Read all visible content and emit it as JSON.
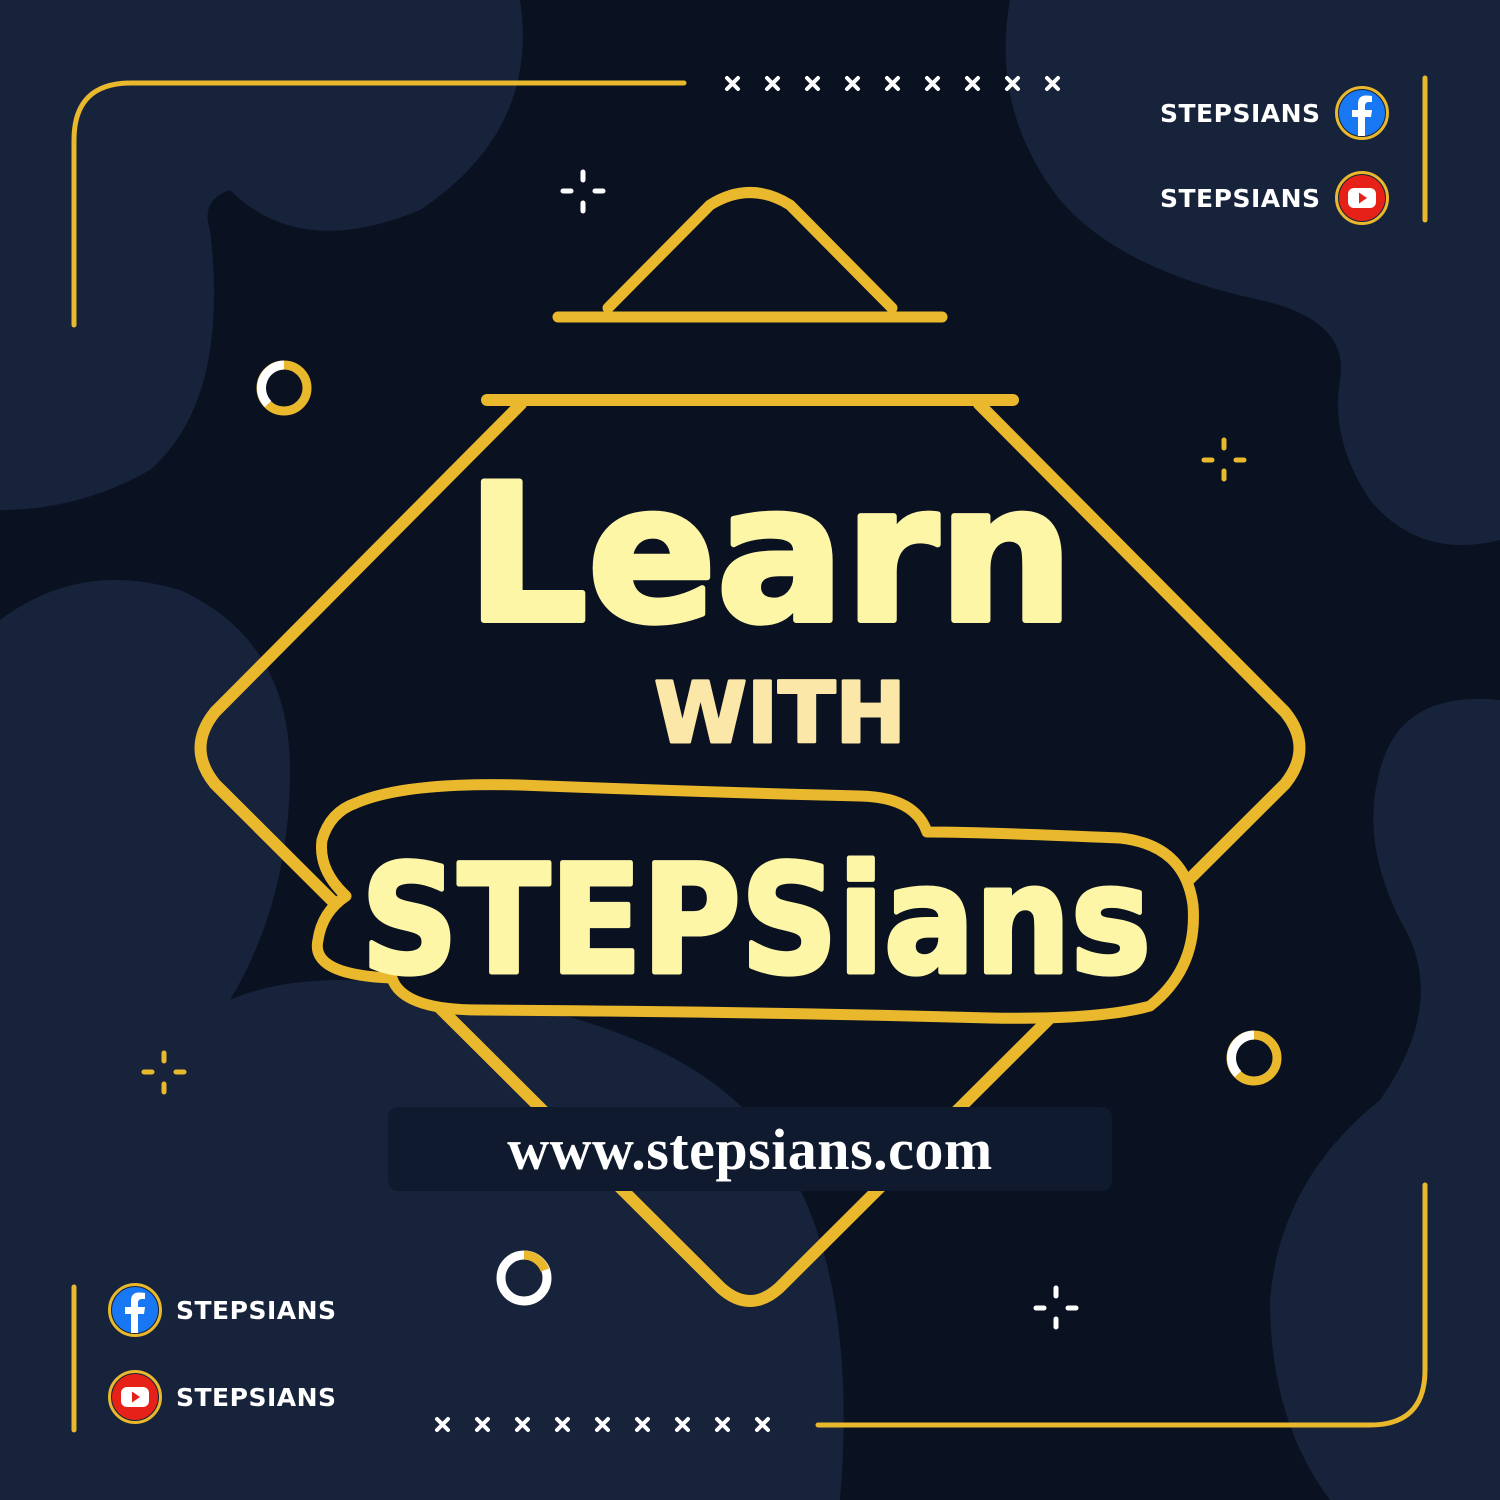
{
  "headline": {
    "line1": "Learn",
    "line2": "WITH",
    "line3": "STEPSians"
  },
  "website": "www.stepsians.com",
  "social": {
    "top": [
      {
        "label": "STEPSIANS",
        "icon": "facebook-icon"
      },
      {
        "label": "STEPSIANS",
        "icon": "youtube-icon"
      }
    ],
    "bottom": [
      {
        "label": "STEPSIANS",
        "icon": "facebook-icon"
      },
      {
        "label": "STEPSIANS",
        "icon": "youtube-icon"
      }
    ]
  },
  "colors": {
    "background": "#0a1222",
    "blob": "#17233a",
    "accent_gold": "#e9b82c",
    "headline_cream": "#fdf6a6",
    "facebook_blue": "#1877f2",
    "youtube_red": "#e62117"
  }
}
